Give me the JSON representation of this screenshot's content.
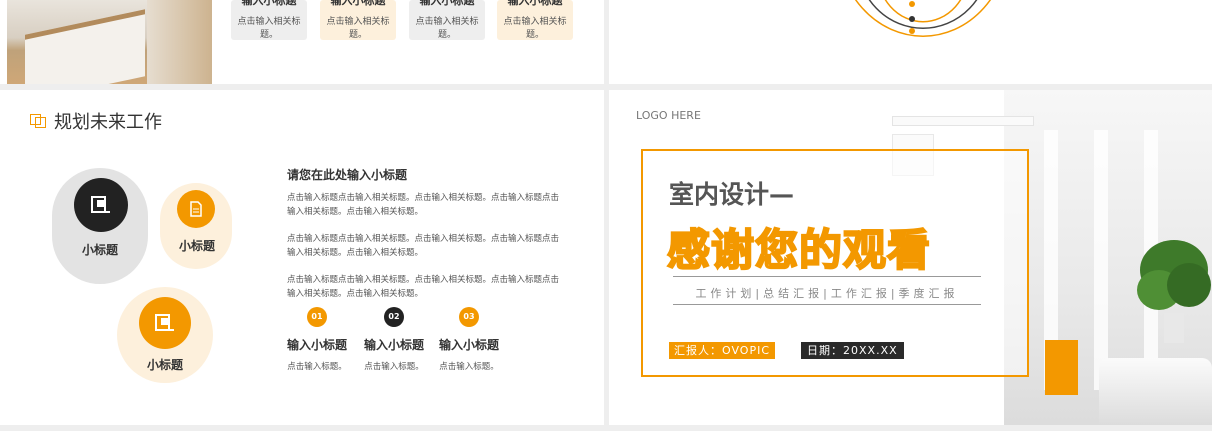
{
  "slide_top_left": {
    "cards": [
      {
        "title": "输入小标题",
        "text": "点击输入相关标题。"
      },
      {
        "title": "输入小标题",
        "text": "点击输入相关标题。"
      },
      {
        "title": "输入小标题",
        "text": "点击输入相关标题。"
      },
      {
        "title": "输入小标题",
        "text": "点击输入相关标题。"
      }
    ]
  },
  "slide_plan": {
    "heading": "规划未来工作",
    "circles": [
      {
        "label": "小标题",
        "icon": "document-icon",
        "color": "#222222"
      },
      {
        "label": "小标题",
        "icon": "file-icon",
        "color": "#f39800"
      },
      {
        "label": "小标题",
        "icon": "document-icon",
        "color": "#f39800"
      }
    ],
    "subheading": "请您在此处输入小标题",
    "paragraphs": [
      "点击输入标题点击输入相关标题。点击输入相关标题。点击输入标题点击输入相关标题。点击输入相关标题。",
      "点击输入标题点击输入相关标题。点击输入相关标题。点击输入标题点击输入相关标题。点击输入相关标题。",
      "点击输入标题点击输入相关标题。点击输入相关标题。点击输入标题点击输入相关标题。点击输入相关标题。"
    ],
    "columns": [
      {
        "num": "01",
        "title": "输入小标题",
        "text": "点击输入标题。",
        "color": "#f39800"
      },
      {
        "num": "02",
        "title": "输入小标题",
        "text": "点击输入标题。",
        "color": "#222222"
      },
      {
        "num": "03",
        "title": "输入小标题",
        "text": "点击输入标题。",
        "color": "#f39800"
      }
    ]
  },
  "slide_thanks": {
    "logo": "LOGO HERE",
    "subtitle": "室内设计—",
    "title": "感谢您的观看",
    "tags": "工作计划|总结汇报|工作汇报|季度汇报",
    "reporter": "汇报人：OVOPIC",
    "date": "日期：20XX.XX"
  },
  "colors": {
    "accent": "#f39800",
    "dark": "#222222"
  }
}
